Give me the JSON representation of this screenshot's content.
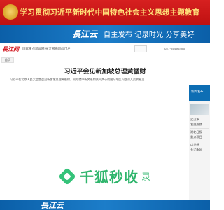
{
  "top_banner": {
    "slogan": "学习贯彻习近平新时代中国特色社会主义思想主题教育",
    "accent": "#d72020",
    "text_color": "#ffe27a"
  },
  "brand_banner": {
    "brand": "長江云",
    "tagline": "自主发布 记录时光 分享美好",
    "accent": "#1c7dc9"
  },
  "header": {
    "logo": "長江网",
    "site_name": "国家重点新闻网 长江网络新闻门户",
    "phone": "027-85495486"
  },
  "tabs": {
    "home": "首页"
  },
  "article": {
    "headline": "习近平会见新加坡总理黄循财",
    "summary": "习近平在北京人民大会堂会见新加坡总理黄循财，双方就中新关系和共同关心的国际地区问题深入交换意见……"
  },
  "sidebar": {
    "heading": "新闻发布",
    "items": [
      "武汉市",
      "发展成就",
      "湖北日报",
      "重点项目",
      "以梦想",
      "长江新区"
    ]
  },
  "watermark": {
    "text": "千狐秒收",
    "domain": "录"
  },
  "footer": {
    "brand": "長江云"
  }
}
